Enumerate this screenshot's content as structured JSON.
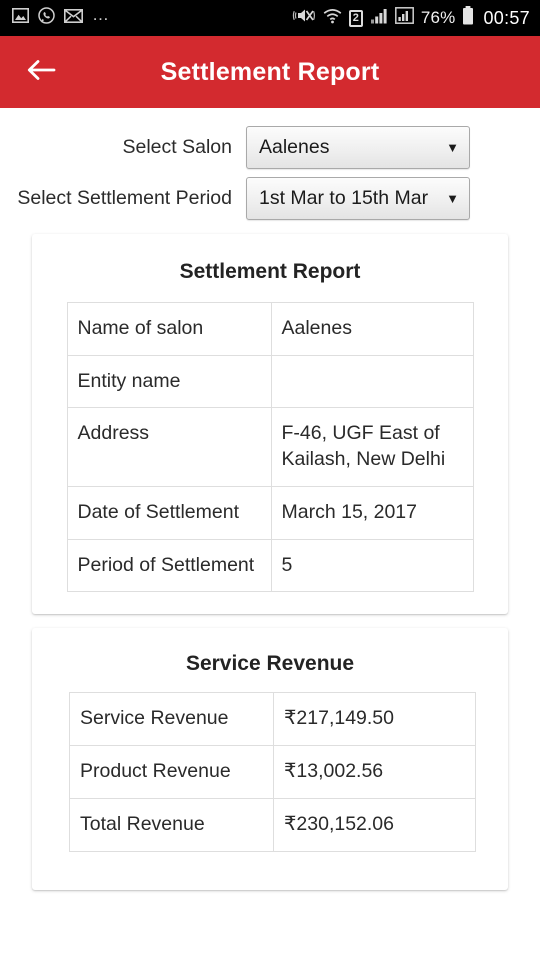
{
  "statusbar": {
    "left_icons": [
      "image-icon",
      "whatsapp-icon",
      "envelope-icon"
    ],
    "overflow": "…",
    "right_icons": [
      "vibrate-mute-icon",
      "wifi-icon",
      "sim-2-icon",
      "signal-1-icon",
      "signal-2-icon",
      "battery-icon"
    ],
    "sim_label": "2",
    "battery_percent": "76%",
    "clock": "00:57"
  },
  "appbar": {
    "back_icon": "arrow-left-icon",
    "title": "Settlement Report",
    "background": "#d32a2f"
  },
  "form": {
    "salon": {
      "label": "Select Salon",
      "value": "Aalenes",
      "caret": "▼"
    },
    "period": {
      "label": "Select Settlement Period",
      "value": "1st Mar to 15th Mar",
      "caret": "▼"
    }
  },
  "report_card": {
    "title": "Settlement Report",
    "rows": [
      {
        "key": "Name of salon",
        "value": "Aalenes"
      },
      {
        "key": "Entity name",
        "value": ""
      },
      {
        "key": "Address",
        "value": "F-46, UGF East of Kailash, New Delhi"
      },
      {
        "key": "Date of Settlement",
        "value": "March 15, 2017"
      },
      {
        "key": "Period of Settlement",
        "value": "5"
      }
    ]
  },
  "revenue_card": {
    "title": "Service Revenue",
    "rows": [
      {
        "key": "Service Revenue",
        "value": "₹217,149.50"
      },
      {
        "key": "Product Revenue",
        "value": "₹13,002.56"
      },
      {
        "key": "Total Revenue",
        "value": "₹230,152.06"
      }
    ]
  }
}
